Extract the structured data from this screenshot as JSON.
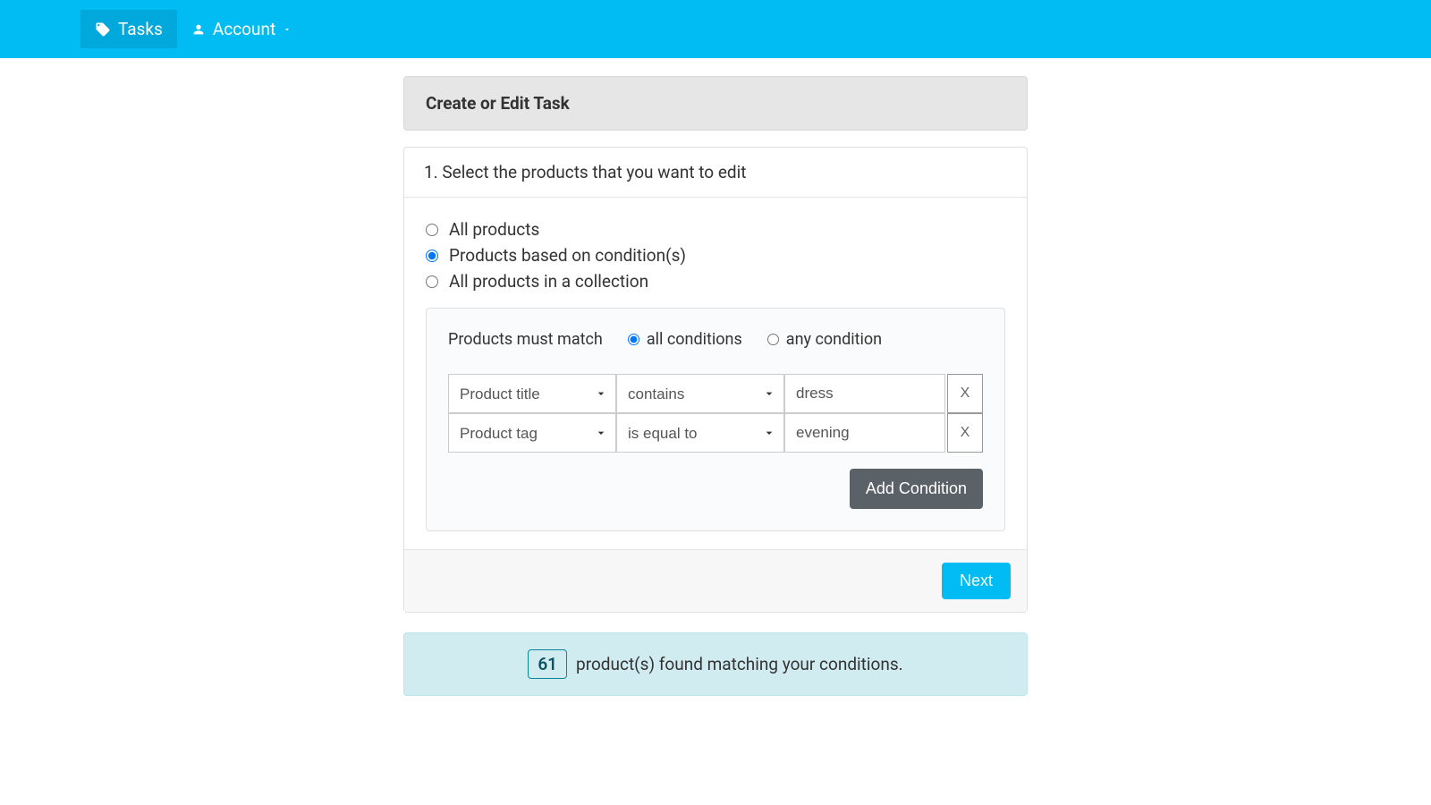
{
  "nav": {
    "tasks_label": "Tasks",
    "account_label": "Account"
  },
  "panel": {
    "title": "Create or Edit Task"
  },
  "step": {
    "title": "1. Select the products that you want to edit"
  },
  "selection": {
    "options": [
      {
        "label": "All products",
        "checked": false
      },
      {
        "label": "Products based on condition(s)",
        "checked": true
      },
      {
        "label": "All products in a collection",
        "checked": false
      }
    ]
  },
  "match": {
    "label": "Products must match",
    "all_label": "all conditions",
    "any_label": "any condition",
    "all_checked": true,
    "any_checked": false
  },
  "conditions": [
    {
      "field": "Product title",
      "operator": "contains",
      "value": "dress",
      "remove": "X"
    },
    {
      "field": "Product tag",
      "operator": "is equal to",
      "value": "evening",
      "remove": "X"
    }
  ],
  "buttons": {
    "add_condition": "Add Condition",
    "next": "Next"
  },
  "result": {
    "count": "61",
    "message": "product(s) found matching your conditions."
  }
}
